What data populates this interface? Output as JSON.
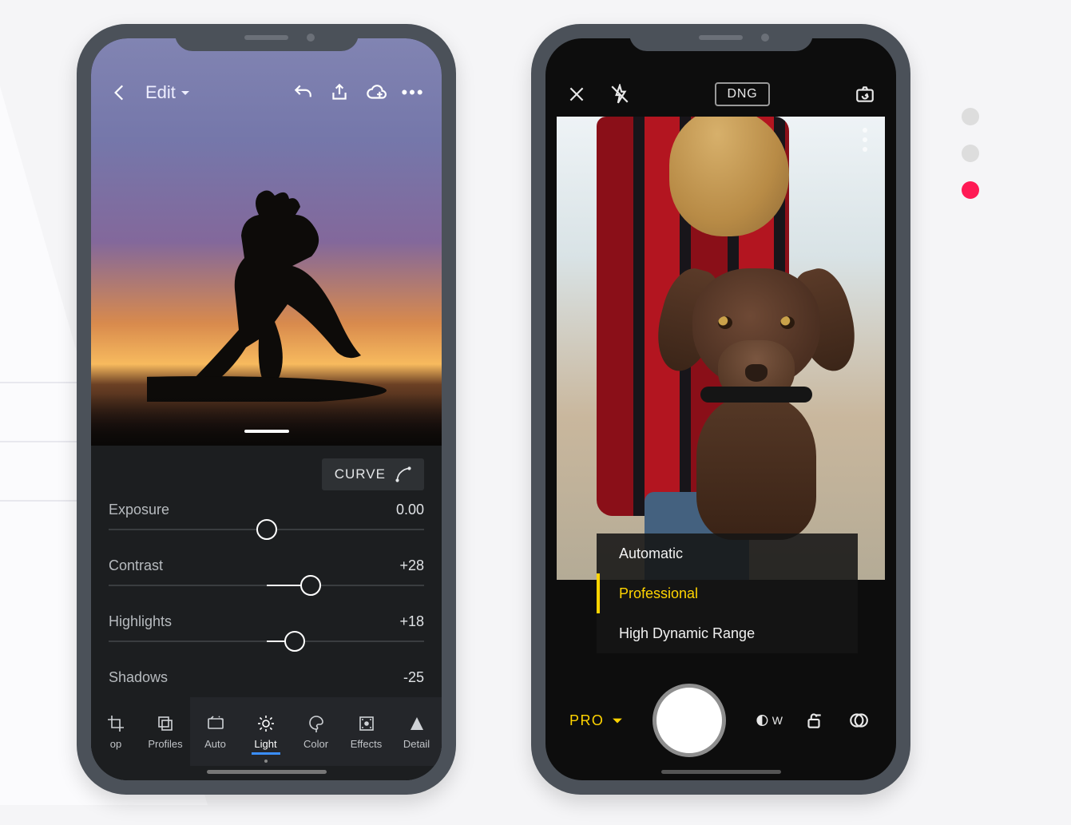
{
  "pager": {
    "dots": 3,
    "active_index": 2
  },
  "phone_a": {
    "toolbar": {
      "back": "Back",
      "title": "Edit",
      "undo": "Undo",
      "share": "Share",
      "cloud": "Cloud sync",
      "more": "More"
    },
    "curve_button": "CURVE",
    "sliders": [
      {
        "label": "Exposure",
        "value": "0.00",
        "pos": 50,
        "fill_from": 50,
        "fill_to": 50
      },
      {
        "label": "Contrast",
        "value": "+28",
        "pos": 64,
        "fill_from": 50,
        "fill_to": 64
      },
      {
        "label": "Highlights",
        "value": "+18",
        "pos": 59,
        "fill_from": 50,
        "fill_to": 59
      },
      {
        "label": "Shadows",
        "value": "-25",
        "pos": 37,
        "fill_from": 37,
        "fill_to": 50
      }
    ],
    "tabs": [
      {
        "id": "crop",
        "label": "op"
      },
      {
        "id": "profiles",
        "label": "Profiles"
      },
      {
        "id": "auto",
        "label": "Auto"
      },
      {
        "id": "light",
        "label": "Light",
        "active": true
      },
      {
        "id": "color",
        "label": "Color"
      },
      {
        "id": "effects",
        "label": "Effects"
      },
      {
        "id": "detail",
        "label": "Detail"
      }
    ]
  },
  "phone_b": {
    "topbar": {
      "close": "Close",
      "flash": "Flash off",
      "format": "DNG",
      "flip": "Flip camera"
    },
    "modes": [
      {
        "id": "auto",
        "label": "Automatic"
      },
      {
        "id": "pro",
        "label": "Professional",
        "selected": true
      },
      {
        "id": "hdr",
        "label": "High Dynamic Range"
      }
    ],
    "bottom": {
      "mode_label": "PRO",
      "wb": "W",
      "lock": "Lock",
      "filter": "Filters"
    }
  }
}
